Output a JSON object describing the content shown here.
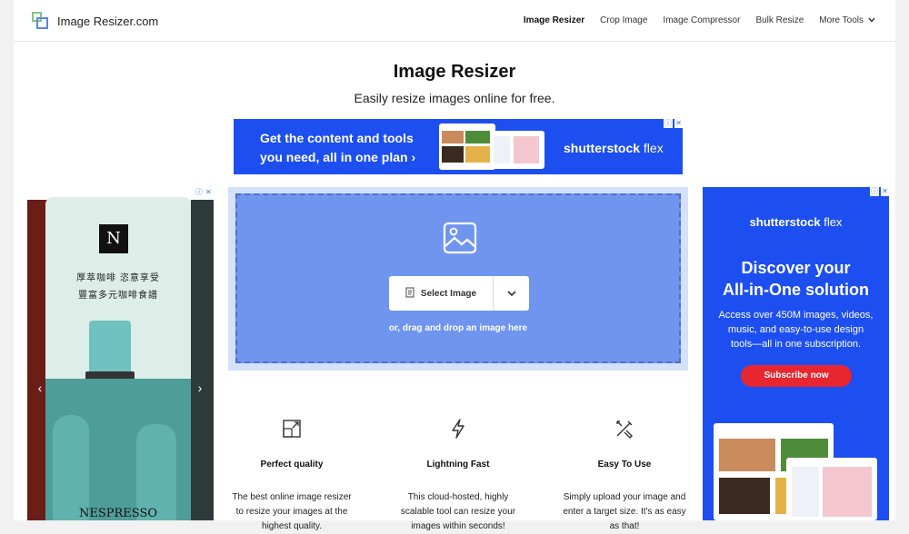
{
  "header": {
    "brand": "Image Resizer.com",
    "nav": [
      {
        "label": "Image Resizer",
        "active": true
      },
      {
        "label": "Crop Image"
      },
      {
        "label": "Image Compressor"
      },
      {
        "label": "Bulk Resize"
      },
      {
        "label": "More Tools"
      }
    ]
  },
  "hero": {
    "title": "Image Resizer",
    "subtitle": "Easily resize images online for free."
  },
  "banner_ad": {
    "line1": "Get the content and tools",
    "line2": "you need, all in one plan",
    "arrow": "›",
    "brand_bold": "shutterstock",
    "brand_light": " flex"
  },
  "upload": {
    "select_label": "Select Image",
    "drop_text": "or, drag and drop an image here"
  },
  "features": [
    {
      "icon": "resize-icon",
      "title": "Perfect quality",
      "desc1": "The best online image resizer",
      "desc2": "to resize your images at the",
      "desc3": "highest quality."
    },
    {
      "icon": "lightning-icon",
      "title": "Lightning Fast",
      "desc1": "This cloud-hosted, highly",
      "desc2": "scalable tool can resize your",
      "desc3": "images within seconds!"
    },
    {
      "icon": "tools-icon",
      "title": "Easy To Use",
      "desc1": "Simply upload your image and",
      "desc2": "enter a target size. It's as easy",
      "desc3": "as that!"
    }
  ],
  "left_ad": {
    "brand_mark": "N",
    "tag1": "厚萃咖啡 恣意享受",
    "tag2": "豐富多元咖啡食譜",
    "footer": "NESPRESSO",
    "prev": "‹",
    "next": "›"
  },
  "right_ad": {
    "brand_bold": "shutterstock",
    "brand_light": " flex",
    "headline1": "Discover your",
    "headline2": "All-in-One solution",
    "body1": "Access over 450M images, videos,",
    "body2": "music, and easy-to-use design",
    "body3": "tools—all in one subscription.",
    "cta": "Subscribe now"
  },
  "colors": {
    "accent": "#6f95ef",
    "shutterstock_blue": "#1d4ff0",
    "cta_red": "#e8262f"
  }
}
